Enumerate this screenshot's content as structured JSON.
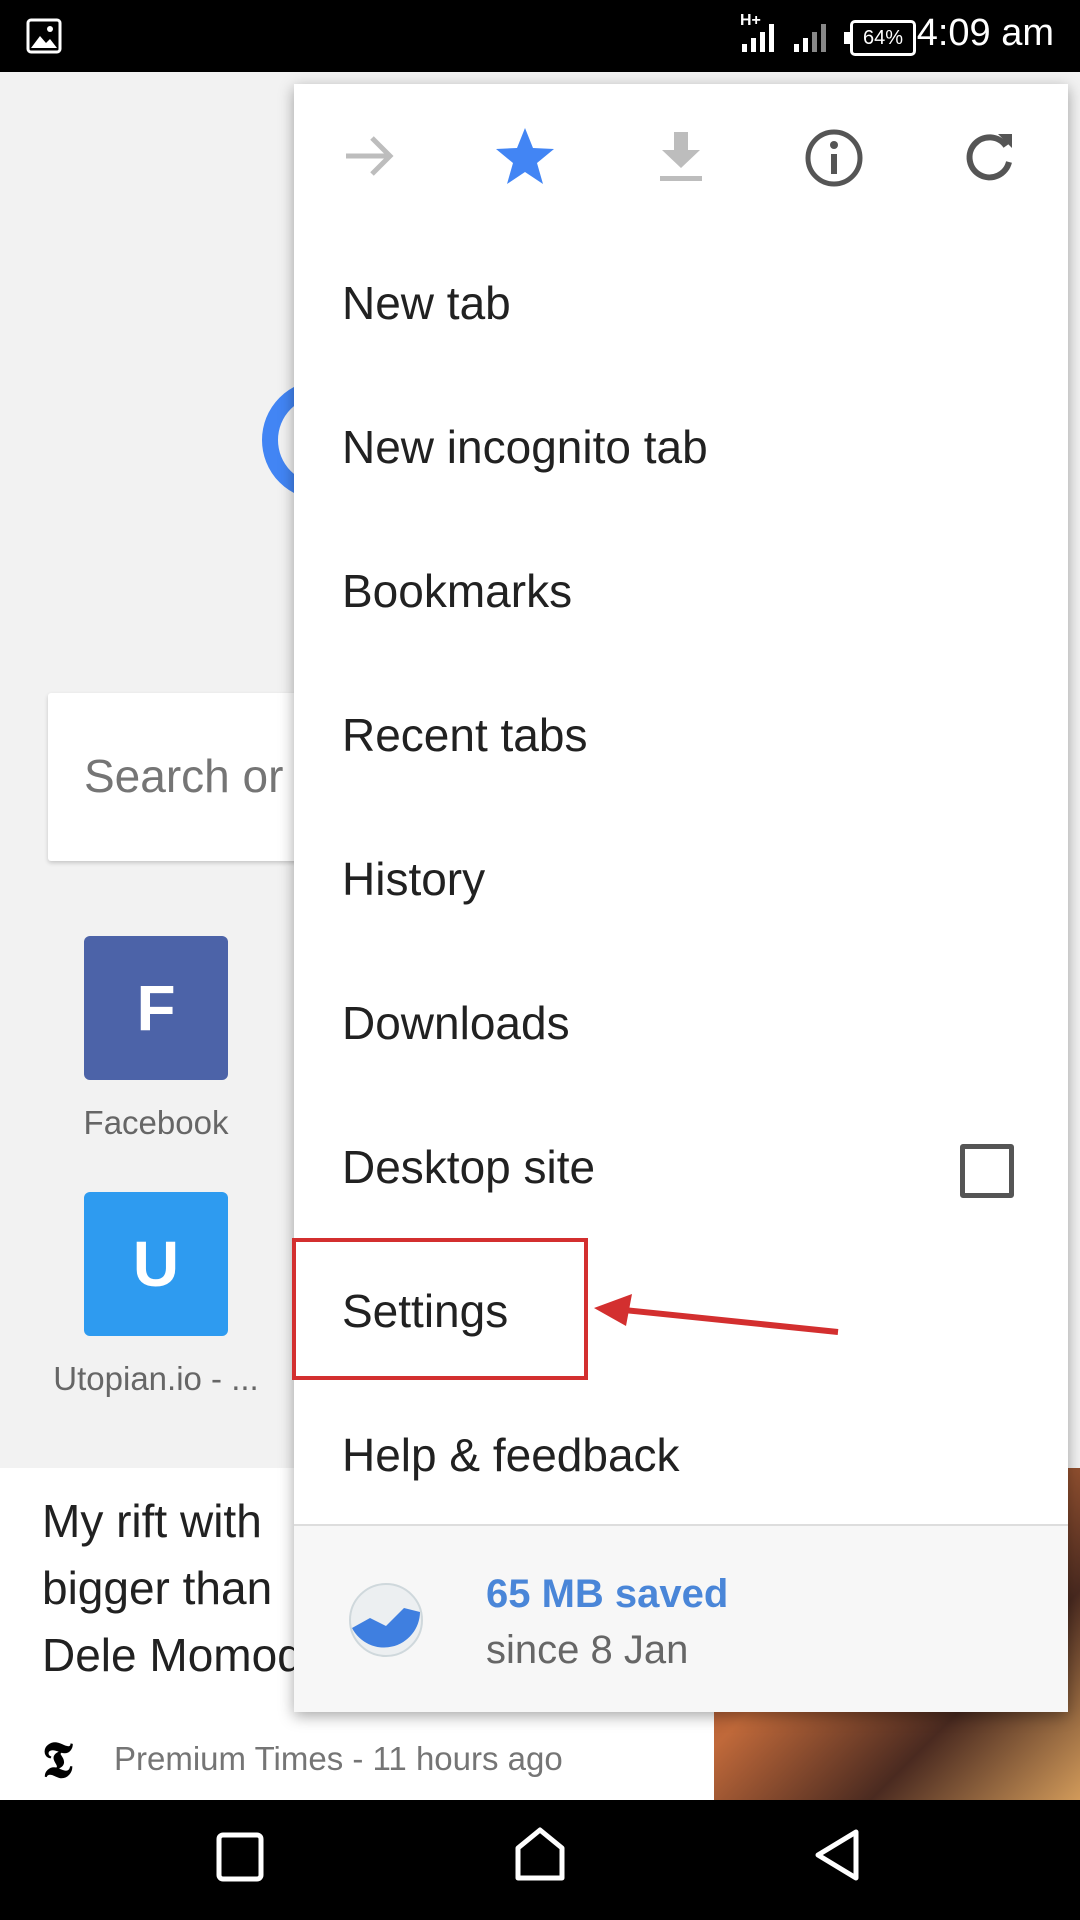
{
  "status_bar": {
    "time": "4:09 am",
    "battery": "64%",
    "network": "H+"
  },
  "background": {
    "search_placeholder": "Search or",
    "tiles": [
      {
        "letter": "F",
        "label": "Facebook",
        "color": "#4c63a8"
      },
      {
        "letter": "U",
        "label": "Utopian.io - ...",
        "color": "#2e9bf0"
      }
    ],
    "article": {
      "headline_lines": [
        "My rift with",
        "bigger than",
        "Dele Momod"
      ],
      "source": "Premium Times - 11 hours ago"
    }
  },
  "menu": {
    "icons": [
      "forward-icon",
      "bookmark-star-icon",
      "download-icon",
      "info-icon",
      "refresh-icon"
    ],
    "items": [
      {
        "label": "New tab"
      },
      {
        "label": "New incognito tab"
      },
      {
        "label": "Bookmarks"
      },
      {
        "label": "Recent tabs"
      },
      {
        "label": "History"
      },
      {
        "label": "Downloads"
      },
      {
        "label": "Desktop site",
        "checkbox": false
      },
      {
        "label": "Settings",
        "highlighted": true
      },
      {
        "label": "Help & feedback"
      }
    ],
    "data_saver": {
      "title": "65 MB saved",
      "subtitle": "since 8 Jan"
    }
  },
  "colors": {
    "accent": "#4285f4",
    "annotation": "#d32f2f"
  }
}
